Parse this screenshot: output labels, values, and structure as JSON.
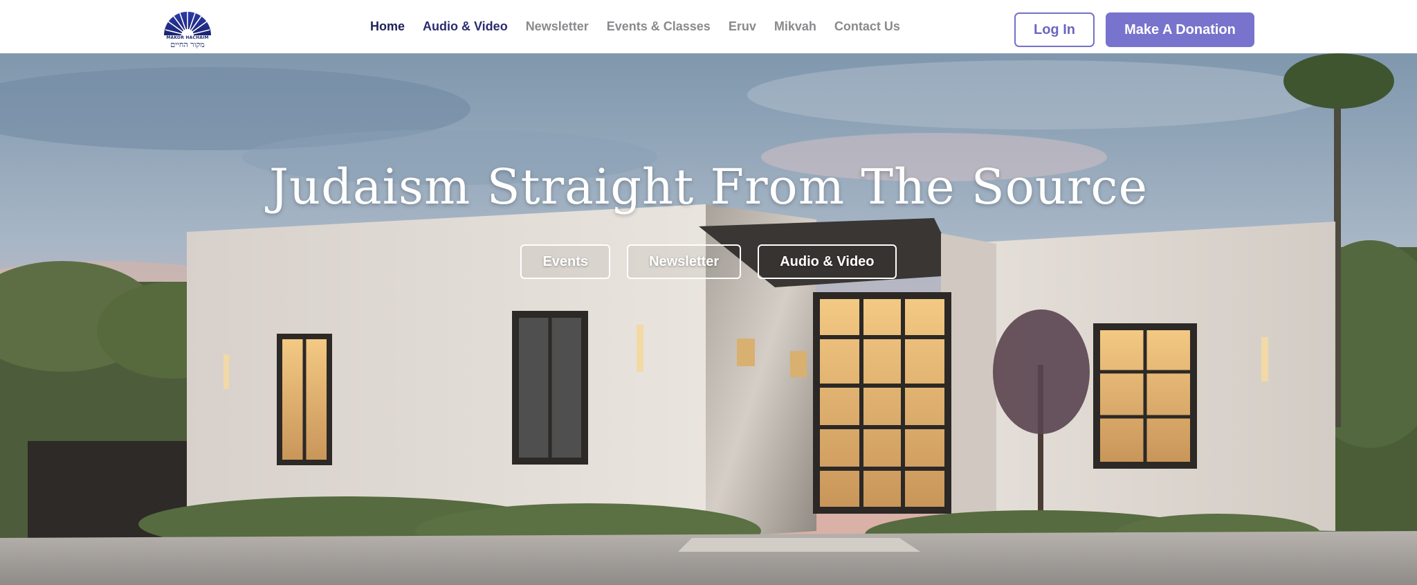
{
  "logo": {
    "name": "MAKOR HACHAIM",
    "hebrew": "מקור החיים"
  },
  "nav": {
    "items": [
      {
        "label": "Home"
      },
      {
        "label": "Audio & Video"
      },
      {
        "label": "Newsletter"
      },
      {
        "label": "Events & Classes"
      },
      {
        "label": "Eruv"
      },
      {
        "label": "Mikvah"
      },
      {
        "label": "Contact Us"
      }
    ]
  },
  "header": {
    "login_label": "Log In",
    "donate_label": "Make A Donation"
  },
  "hero": {
    "title": "Judaism Straight From The Source",
    "buttons": [
      {
        "label": "Events"
      },
      {
        "label": "Newsletter"
      },
      {
        "label": "Audio & Video"
      }
    ]
  },
  "colors": {
    "brand_dark": "#1f2159",
    "accent": "#7873cc",
    "nav_inactive": "#8a8a8e"
  }
}
